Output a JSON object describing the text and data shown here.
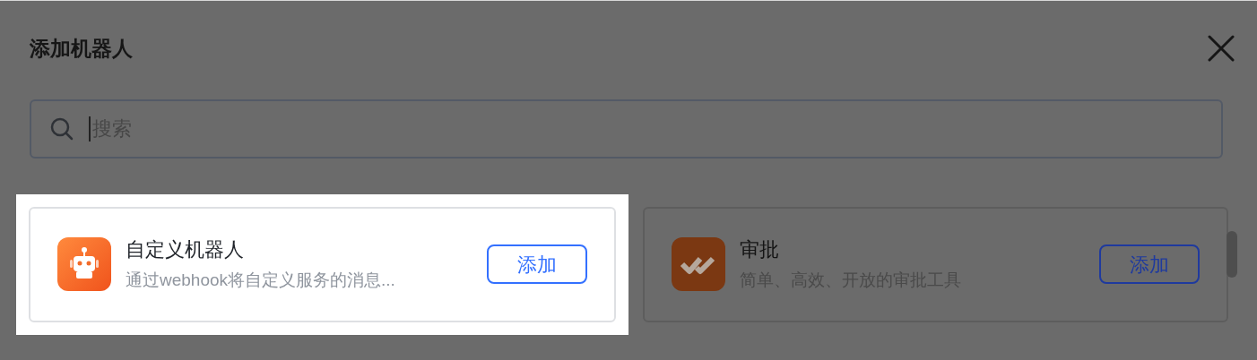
{
  "dialog": {
    "title": "添加机器人",
    "search": {
      "placeholder": "搜索"
    },
    "bots": [
      {
        "name": "自定义机器人",
        "description": "通过webhook将自定义服务的消息...",
        "button": "添加",
        "kind": "robot",
        "highlighted": true
      },
      {
        "name": "审批",
        "description": "简单、高效、开放的审批工具",
        "button": "添加",
        "kind": "approval",
        "highlighted": false
      }
    ]
  }
}
